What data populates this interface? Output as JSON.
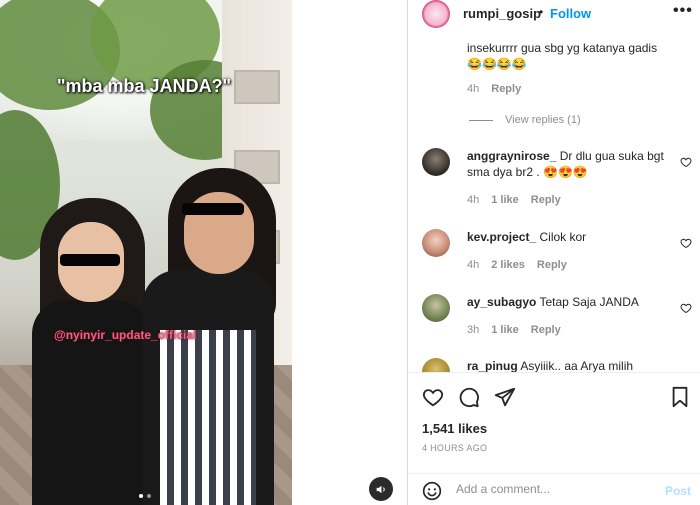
{
  "video": {
    "caption_overlay": "\"mba mba JANDA?\"",
    "watermark": "@nyinyir_update_official"
  },
  "header": {
    "username": "rumpi_gosip",
    "separator": "•",
    "follow_label": "Follow",
    "more_label": "•••"
  },
  "comments": [
    {
      "username": "",
      "text": "insekurrrr gua sbg yg katanya gadis 😂😂😂😂",
      "time": "4h",
      "likes": "",
      "reply_label": "Reply"
    },
    {
      "username": "anggraynirose_",
      "text": "Dr dlu gua suka bgt sma dya br2 . 😍😍😍",
      "time": "4h",
      "likes": "1 like",
      "reply_label": "Reply"
    },
    {
      "username": "kev.project_",
      "text": "Cilok kor",
      "time": "4h",
      "likes": "2 likes",
      "reply_label": "Reply"
    },
    {
      "username": "ay_subagyo",
      "text": "Tetap Saja JANDA",
      "time": "3h",
      "likes": "1 like",
      "reply_label": "Reply"
    },
    {
      "username": "ra_pinug",
      "text": "Asyiiik.. aa Arya milih"
    }
  ],
  "view_replies_label": "View replies (1)",
  "post": {
    "likes": "1,541 likes",
    "time_ago": "4 HOURS AGO"
  },
  "add_comment": {
    "placeholder": "Add a comment...",
    "post_label": "Post"
  }
}
